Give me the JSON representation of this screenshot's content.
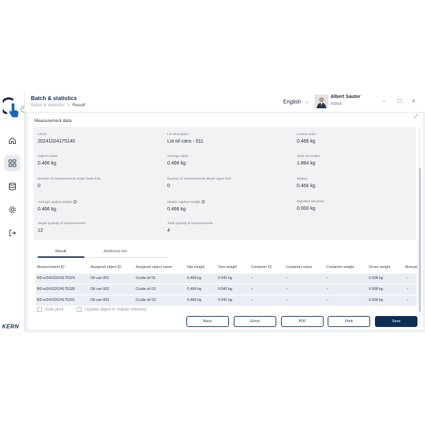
{
  "header": {
    "title": "Batch & statistics",
    "breadcrumb_parent": "Batch & statistics",
    "breadcrumb_sep": ">",
    "breadcrumb_current": "Result",
    "language": "English",
    "user_name": "Albert Sauter",
    "user_role": "Admin"
  },
  "window": {
    "minimize": "–",
    "maximize": "☐",
    "close": "✕"
  },
  "rail": {
    "brand": "KERN",
    "icons": [
      "hand-touch-icon",
      "home-icon",
      "grid-icon",
      "database-icon",
      "gear-icon",
      "logout-icon"
    ]
  },
  "panel": {
    "title": "Measurement data"
  },
  "fields": {
    "lot_id": {
      "label": "Lot ID",
      "value": "20241024175140"
    },
    "lot_description": {
      "label": "Lot description",
      "value": "Lot oil cans - 011"
    },
    "lowest_value": {
      "label": "Lowest value",
      "value": "0.466 kg"
    },
    "highest_value": {
      "label": "Highest value",
      "value": "0.466 kg"
    },
    "average_value": {
      "label": "Average value",
      "value": "0.466 kg"
    },
    "total_net_weight": {
      "label": "Total net weight",
      "value": "1.864 kg"
    },
    "under_lower": {
      "label": "Number of measurements under lower limit",
      "value": "0"
    },
    "above_upper": {
      "label": "Number of measurements above upper limit",
      "value": "0"
    },
    "median": {
      "label": "Median",
      "value": "0.466 kg"
    },
    "avg_applied": {
      "label": "Average applied weight",
      "value": "0.466 kg"
    },
    "median_applied": {
      "label": "Median applied weight",
      "value": "0.466 kg"
    },
    "std_dev": {
      "label": "Standard deviation",
      "value": "0.000 kg"
    },
    "target_qty": {
      "label": "Target quantity of measurements",
      "value": "12"
    },
    "total_qty": {
      "label": "Total quantity of measurements",
      "value": "4"
    }
  },
  "tabs": [
    {
      "label": "Result",
      "active": true
    },
    {
      "label": "Additional info",
      "active": false
    }
  ],
  "table": {
    "columns": [
      "Measurement ID",
      "Assigned object ID",
      "Assigned object name",
      "Net weight",
      "Tare weight",
      "Container ID",
      "Container name",
      "Container weight",
      "Gross weight",
      "Manual"
    ],
    "rows": [
      [
        "BD-w24102024175324",
        "Oil can 001",
        "Crude oil 01",
        "0.466  kg",
        "0.042 kg",
        "–",
        "–",
        "–",
        "0.508 kg",
        "–"
      ],
      [
        "BD-w24102024175328",
        "Oil can 002",
        "Crude oil 02",
        "0.466  kg",
        "0.042 kg",
        "–",
        "–",
        "–",
        "0.508 kg",
        "–"
      ],
      [
        "BD-w24102024175331",
        "Oil can 003",
        "Crude oil 03",
        "0.466  kg",
        "0.042 kg",
        "–",
        "–",
        "–",
        "0.508 kg",
        "–"
      ]
    ]
  },
  "options": {
    "auto_print": "Auto print",
    "update_object": "Update object in master memory"
  },
  "buttons": {
    "back": "Back",
    "excel": "Excel",
    "pdf": "PDF",
    "print": "Print",
    "save": "Save"
  },
  "colors": {
    "brand": "#0f2d55",
    "row_bg": "#eaeef4",
    "card_bg": "#f1f2f4"
  }
}
